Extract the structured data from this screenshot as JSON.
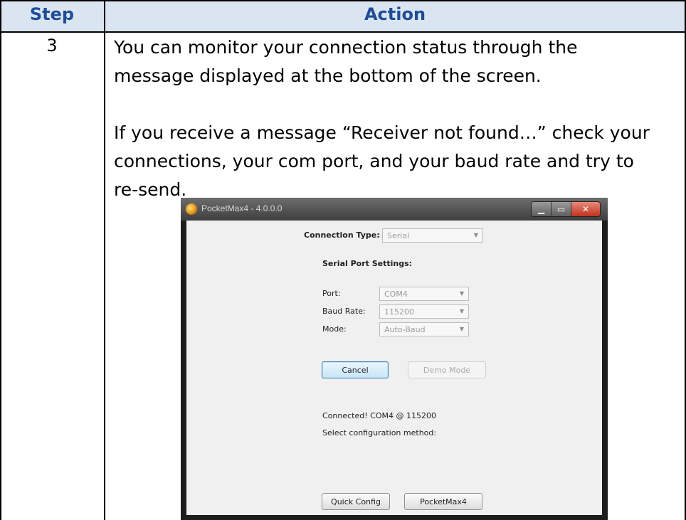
{
  "table": {
    "header_step": "Step",
    "header_action": "Action",
    "step_number": "3",
    "paragraph1_lines": [
      "You can monitor your connection status through the",
      "message displayed at the bottom of the screen."
    ],
    "paragraph2_lines": [
      "If you receive a message “Receiver not found…” check your",
      "connections, your com port, and your baud rate and try to",
      "re-send."
    ],
    "header_bg": "#dbe5f1",
    "header_text_color": "#1f4e96"
  },
  "window": {
    "title": "PocketMax4 - 4.0.0.0",
    "app_icon": "pocketmax-logo-icon",
    "controls": {
      "minimize": "▁",
      "maximize": "▭",
      "close": "✕"
    },
    "connection_type_label": "Connection Type:",
    "connection_type_value": "Serial",
    "serial_settings_heading": "Serial Port Settings:",
    "port_label": "Port:",
    "port_value": "COM4",
    "baud_label": "Baud Rate:",
    "baud_value": "115200",
    "mode_label": "Mode:",
    "mode_value": "Auto-Baud",
    "cancel_label": "Cancel",
    "demo_label": "Demo Mode",
    "status_line1": "Connected! COM4 @ 115200",
    "status_line2": "Select configuration method:",
    "quick_config_label": "Quick Config",
    "pocketmax4_label": "PocketMax4",
    "dropdown_icon": "chevron-down-icon"
  }
}
